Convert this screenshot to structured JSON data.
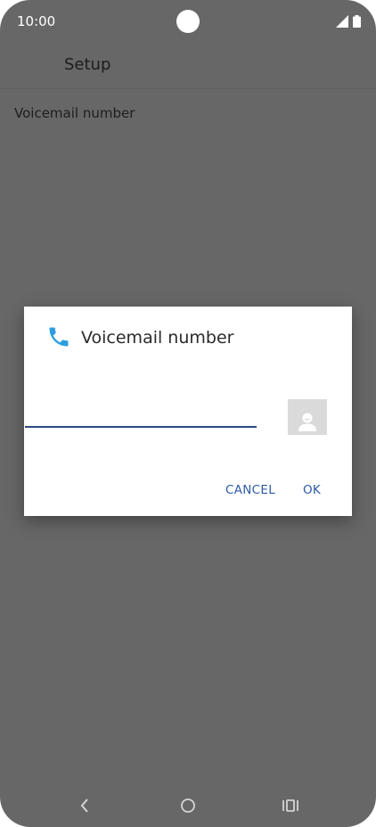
{
  "status_bar": {
    "time": "10:00",
    "icons": [
      "signal-icon",
      "battery-icon"
    ]
  },
  "app_bar": {
    "title": "Setup"
  },
  "settings": {
    "voicemail_row_label": "Voicemail number"
  },
  "dialog": {
    "icon": "phone-icon",
    "title": "Voicemail number",
    "input_value": "",
    "contact_icon": "contact-picker-icon",
    "cancel_label": "CANCEL",
    "ok_label": "OK"
  },
  "nav_bar": {
    "items": [
      "back-icon",
      "home-icon",
      "recents-icon"
    ]
  },
  "colors": {
    "dim_background": "#676767",
    "dialog_background": "#ffffff",
    "accent": "#2d5aa7",
    "phone_icon": "#2b9ee0",
    "input_underline": "#2b4a82"
  }
}
